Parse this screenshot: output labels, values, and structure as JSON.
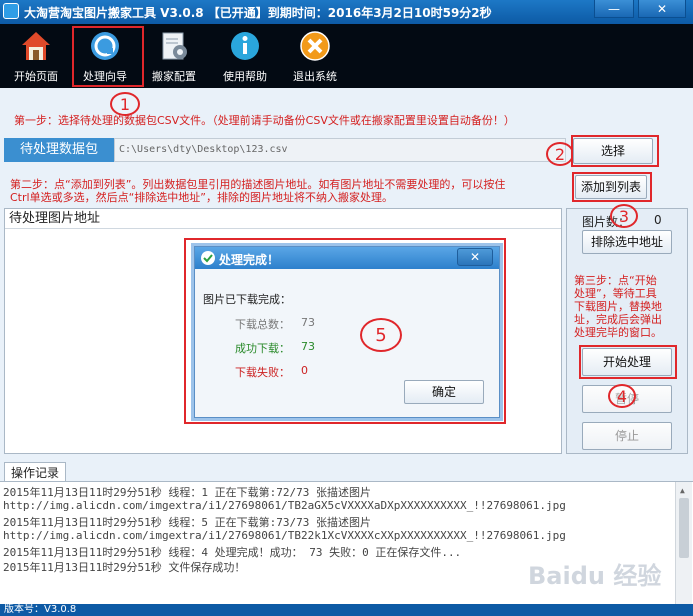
{
  "window": {
    "title": "大淘营淘宝图片搬家工具 V3.0.8  【已开通】到期时间：2016年3月2日10时59分2秒",
    "minimize": "—",
    "close": "✕"
  },
  "toolbar": {
    "items": [
      {
        "label": "开始页面",
        "icon": "home-icon"
      },
      {
        "label": "处理向导",
        "icon": "wizard-icon"
      },
      {
        "label": "搬家配置",
        "icon": "config-icon"
      },
      {
        "label": "使用帮助",
        "icon": "help-icon"
      },
      {
        "label": "退出系统",
        "icon": "exit-icon"
      }
    ]
  },
  "markers": [
    "1",
    "2",
    "3",
    "4",
    "5"
  ],
  "step1": "第一步：选择待处理的数据包CSV文件。（处理前请手动备份CSV文件或在搬家配置里设置自动备份！）",
  "file": {
    "label": "待处理数据包",
    "path": "C:\\Users\\dty\\Desktop\\123.csv"
  },
  "select_button": "选择",
  "add_button": "添加到列表",
  "step2_line1": "第二步：点“添加到列表”。列出数据包里引用的描述图片地址。如有图片地址不需要处理的，可以按住",
  "step2_line2": "Ctrl单选或多选，然后点“排除选中地址”，排除的图片地址将不纳入搬家处理。",
  "list_header": "待处理图片地址",
  "image_count_label": "图片数：",
  "image_count": "0",
  "exclude_button": "排除选中地址",
  "step3": [
    "第三步：点“开始",
    "处理”，等待工具",
    "下载图片，替换地",
    "址，完成后会弹出",
    "处理完毕的窗口。"
  ],
  "start_button": "开始处理",
  "pause_button": "暂停",
  "stop_button": "停止",
  "dialog": {
    "title": "处理完成！",
    "close": "✕",
    "heading": "图片已下载完成：",
    "total_label": "下载总数：",
    "total": "73",
    "success_label": "成功下载：",
    "success": "73",
    "fail_label": "下载失败：",
    "fail": "0",
    "ok": "确定"
  },
  "log": {
    "tab": "操作记录",
    "lines": [
      "2015年11月13日11时29分51秒 线程：1  正在下载第:72/73 张描述图片",
      "http://img.alicdn.com/imgextra/i1/27698061/TB2aGX5cVXXXXaDXpXXXXXXXXXX_!!27698061.jpg",
      "2015年11月13日11时29分51秒 线程：5  正在下载第:73/73 张描述图片",
      "http://img.alicdn.com/imgextra/i1/27698061/TB22k1XcVXXXXcXXpXXXXXXXXXX_!!27698061.jpg",
      "2015年11月13日11时29分51秒 线程：4 处理完成！成功： 73 失败：0 正在保存文件...",
      "2015年11月13日11时29分51秒 文件保存成功！"
    ]
  },
  "status": "版本号：V3.0.8",
  "watermark": "Baidu 经验",
  "colors": {
    "accent": "#0d5aa5",
    "annotation": "#e0272b",
    "success": "#2a8a2a",
    "fail": "#cc2222"
  }
}
